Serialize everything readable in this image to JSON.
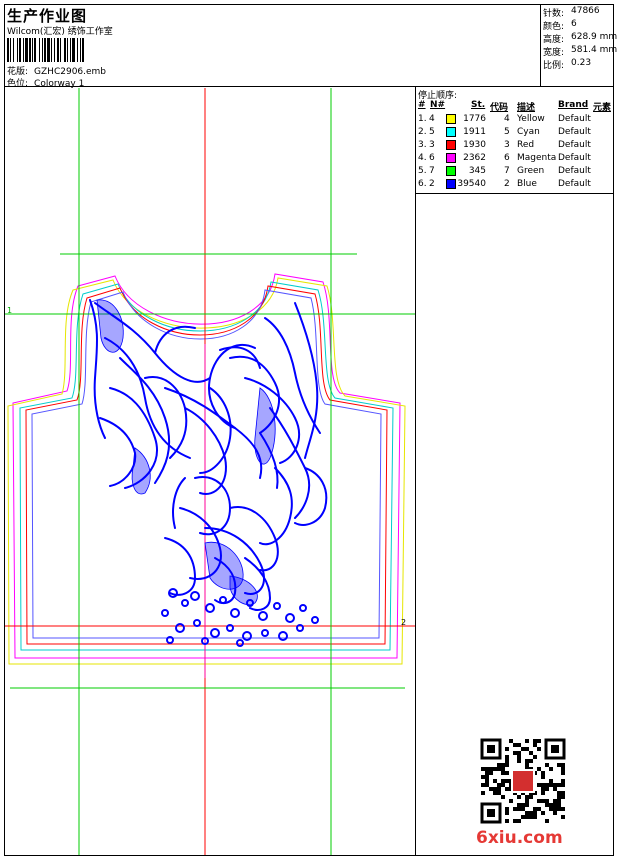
{
  "header": {
    "title": "生产作业图",
    "company": "Wilcom(汇宏) 绣饰工作室",
    "design_label": "花版:",
    "design_value": "GZHC2906.emb",
    "colorway_label": "色位:",
    "colorway_value": "Colorway 1"
  },
  "stats": {
    "stitches_label": "针数:",
    "stitches_value": "47866",
    "colors_label": "颜色:",
    "colors_value": "6",
    "height_label": "高度:",
    "height_value": "628.9 mm",
    "width_label": "宽度:",
    "width_value": "581.4 mm",
    "scale_label": "比例:",
    "scale_value": "0.23"
  },
  "stop_sequence": {
    "title": "停止顺序:",
    "columns": [
      "#",
      "N#",
      "St.",
      "代码",
      "描述",
      "Brand",
      "元素"
    ],
    "rows": [
      {
        "idx": "1.",
        "n": "4",
        "color": "#ffff00",
        "st": "1776",
        "code": "4",
        "desc": "Yellow",
        "brand": "Default"
      },
      {
        "idx": "2.",
        "n": "5",
        "color": "#00ffff",
        "st": "1911",
        "code": "5",
        "desc": "Cyan",
        "brand": "Default"
      },
      {
        "idx": "3.",
        "n": "3",
        "color": "#ff0000",
        "st": "1930",
        "code": "3",
        "desc": "Red",
        "brand": "Default"
      },
      {
        "idx": "4.",
        "n": "6",
        "color": "#ff00ff",
        "st": "2362",
        "code": "6",
        "desc": "Magenta",
        "brand": "Default"
      },
      {
        "idx": "5.",
        "n": "7",
        "color": "#00ff00",
        "st": "345",
        "code": "7",
        "desc": "Green",
        "brand": "Default"
      },
      {
        "idx": "6.",
        "n": "2",
        "color": "#0000ff",
        "st": "39540",
        "code": "2",
        "desc": "Blue",
        "brand": "Default"
      }
    ]
  },
  "guides": {
    "marker_1": "1",
    "marker_2": "2"
  },
  "watermark": {
    "site": "6xiu.com"
  },
  "colors": {
    "embroidery": "#0000ff",
    "guide_red": "#ff0000",
    "guide_green": "#00cc00"
  }
}
